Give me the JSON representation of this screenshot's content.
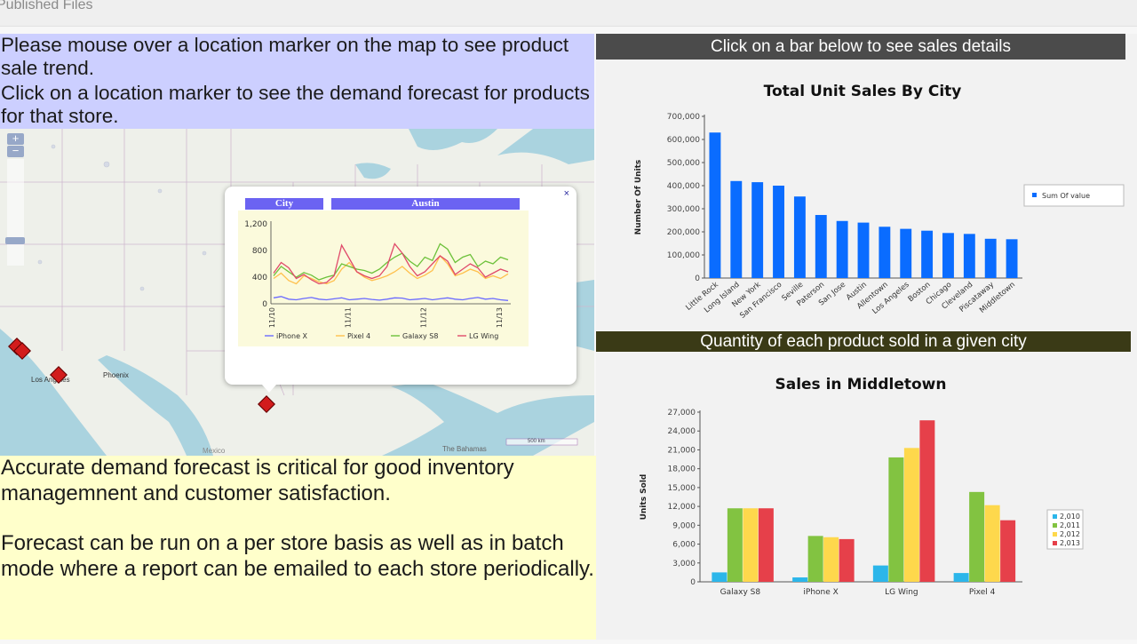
{
  "topbar": {
    "title": "Published Files"
  },
  "instructions": {
    "line1": "Please mouse over a location marker on the map to see product sale trend.",
    "line2": "Click on a location marker to see the demand forecast for products for that store."
  },
  "map": {
    "labels": {
      "los_angeles": "Los Angeles",
      "phoenix": "Phoenix",
      "mexico": "Mexico",
      "bahamas": "The Bahamas",
      "scale": "500 km"
    },
    "zoom_in": "+",
    "zoom_out": "−",
    "popup": {
      "header_label": "City",
      "header_value": "Austin",
      "close": "×",
      "mini_chart": {
        "type": "line",
        "x_ticks": [
          "11/10",
          "11/11",
          "11/12",
          "11/13"
        ],
        "y_ticks": [
          "1,200",
          "800",
          "400",
          "0"
        ],
        "ylim": [
          0,
          1200
        ],
        "colors": [
          "#6a6aff",
          "#ffc04d",
          "#6cc13a",
          "#e04a6a"
        ],
        "series": [
          {
            "name": "iPhone X",
            "values": [
              90,
              110,
              70,
              60,
              80,
              95,
              70,
              60,
              75,
              90,
              60,
              70,
              80,
              65,
              55,
              70,
              90,
              85,
              60,
              70,
              80,
              60,
              75,
              90,
              70,
              60,
              80,
              95,
              70,
              80,
              60,
              50
            ]
          },
          {
            "name": "Pixel 4",
            "values": [
              380,
              460,
              350,
              300,
              420,
              380,
              330,
              300,
              350,
              520,
              620,
              480,
              400,
              350,
              380,
              420,
              480,
              560,
              460,
              380,
              430,
              500,
              720,
              600,
              420,
              460,
              520,
              480,
              380,
              420,
              380,
              450
            ]
          },
          {
            "name": "Galaxy S8",
            "values": [
              420,
              560,
              480,
              400,
              470,
              430,
              360,
              400,
              430,
              600,
              560,
              520,
              500,
              460,
              520,
              620,
              700,
              760,
              640,
              560,
              700,
              650,
              900,
              820,
              620,
              700,
              740,
              560,
              640,
              600,
              700,
              660
            ]
          },
          {
            "name": "LG Wing",
            "values": [
              460,
              620,
              540,
              380,
              440,
              360,
              300,
              320,
              420,
              880,
              680,
              480,
              420,
              380,
              420,
              560,
              900,
              760,
              560,
              420,
              480,
              600,
              720,
              640,
              440,
              520,
              600,
              540,
              400,
              460,
              520,
              480
            ]
          }
        ]
      }
    }
  },
  "info": {
    "para1": "Accurate demand forecast is critical for good inventory managemnent and customer satisfaction.",
    "para2": "Forecast can be run on a per store basis as well as in batch mode where a report can be emailed to each store periodically."
  },
  "right": {
    "header1": "Click on a bar below to see sales details",
    "header2": "Quantity of each product sold in a given city"
  },
  "chart_data": [
    {
      "type": "bar",
      "title": "Total Unit Sales By City",
      "ylabel": "Number Of Units",
      "xlabel": "",
      "ylim": [
        0,
        700000
      ],
      "y_ticks": [
        "0",
        "100,000",
        "200,000",
        "300,000",
        "400,000",
        "500,000",
        "600,000",
        "700,000"
      ],
      "legend_position": "right",
      "color": "#0a6cff",
      "categories": [
        "Little Rock",
        "Long Island",
        "New York",
        "San Francisco",
        "Seville",
        "Paterson",
        "San Jose",
        "Austin",
        "Allentown",
        "Los Angeles",
        "Boston",
        "Chicago",
        "Cleveland",
        "Piscataway",
        "Middletown"
      ],
      "series": [
        {
          "name": "Sum Of value",
          "values": [
            630000,
            420000,
            415000,
            400000,
            353000,
            273000,
            247000,
            240000,
            222000,
            213000,
            205000,
            195000,
            191000,
            170000,
            168000
          ]
        }
      ]
    },
    {
      "type": "bar",
      "title": "Sales in Middletown",
      "ylabel": "Units Sold",
      "xlabel": "",
      "ylim": [
        0,
        27000
      ],
      "y_ticks": [
        "0",
        "3,000",
        "6,000",
        "9,000",
        "12,000",
        "15,000",
        "18,000",
        "21,000",
        "24,000",
        "27,000"
      ],
      "legend_position": "right",
      "categories": [
        "Galaxy S8",
        "iPhone X",
        "LG Wing",
        "Pixel 4"
      ],
      "series": [
        {
          "name": "2,010",
          "color": "#2cb6ea",
          "values": [
            1500,
            700,
            2600,
            1400
          ]
        },
        {
          "name": "2,011",
          "color": "#82c341",
          "values": [
            11700,
            7300,
            19800,
            14300
          ]
        },
        {
          "name": "2,012",
          "color": "#fed84c",
          "values": [
            11700,
            7100,
            21300,
            12200
          ]
        },
        {
          "name": "2,013",
          "color": "#e6404a",
          "values": [
            11700,
            6800,
            25700,
            9800
          ]
        }
      ]
    }
  ]
}
